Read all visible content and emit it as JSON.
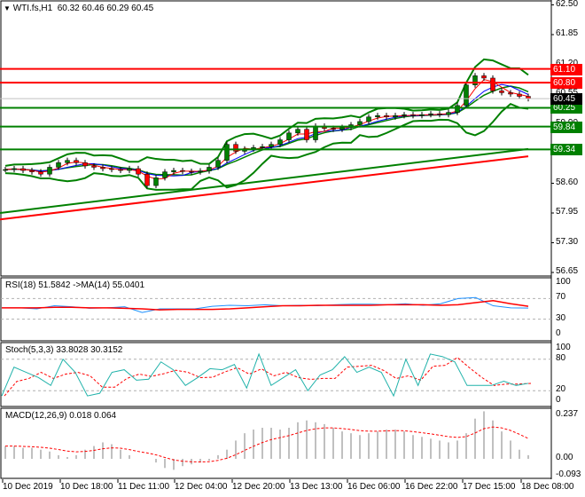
{
  "header": {
    "symbol": "WTI.fs,H1",
    "ohlc": "60.32 60.46 60.29 60.45"
  },
  "panels": {
    "rsi": {
      "title": "RSI(18) 51.5842  ->MA(14) 55.0401",
      "ticks": [
        "100",
        "70",
        "30",
        "0"
      ]
    },
    "stoch": {
      "title": "Stoch(5,3,3) 33.8028 30.3152",
      "ticks": [
        "100",
        "80",
        "20",
        "0"
      ]
    },
    "macd": {
      "title": "MACD(12,26,9) 0.018 0.064",
      "ticks": [
        "0.237",
        "0.00",
        "-0.093"
      ]
    }
  },
  "colors": {
    "bull": "#008000",
    "bear": "#ff0000",
    "red": "#ff0000",
    "green": "#008000",
    "blue": "#0000ff",
    "rsi": "#1e90ff",
    "stoch": "#20b2aa",
    "hist": "#c0c0c0"
  },
  "chart_data": [
    {
      "type": "candlestick",
      "title": "WTI.fs,H1",
      "ylim": [
        56.65,
        62.5
      ],
      "yticks": [
        "62.50",
        "61.85",
        "61.20",
        "60.55",
        "59.90",
        "59.25",
        "58.60",
        "57.95",
        "57.30",
        "56.65"
      ],
      "closes": [
        58.9,
        58.92,
        58.88,
        58.85,
        58.8,
        58.95,
        59.05,
        59.1,
        59.05,
        58.98,
        58.95,
        58.92,
        58.9,
        58.88,
        58.92,
        58.8,
        58.55,
        58.72,
        58.85,
        58.88,
        58.86,
        58.85,
        58.87,
        58.95,
        59.1,
        59.45,
        59.3,
        59.35,
        59.38,
        59.4,
        59.45,
        59.55,
        59.7,
        59.78,
        59.55,
        59.85,
        59.8,
        59.78,
        59.82,
        59.88,
        59.95,
        60.05,
        60.08,
        60.05,
        60.08,
        60.1,
        60.08,
        60.1,
        60.12,
        60.1,
        60.15,
        60.3,
        60.75,
        60.95,
        60.9,
        60.62,
        60.58,
        60.55,
        60.5,
        60.45
      ],
      "levels": [
        {
          "price": "61.10",
          "color": "red"
        },
        {
          "price": "60.80",
          "color": "red"
        },
        {
          "price": "60.25",
          "color": "green"
        },
        {
          "price": "59.84",
          "color": "green"
        },
        {
          "price": "59.34",
          "color": "green"
        }
      ],
      "current_price": "60.45",
      "long_ma": [
        {
          "color": "green",
          "start": 57.95,
          "end": 59.35
        },
        {
          "color": "red",
          "start": 57.81,
          "end": 59.19
        }
      ]
    },
    {
      "type": "line",
      "title": "RSI(18)",
      "ylim": [
        0,
        100
      ],
      "rsi": [
        52,
        52,
        50,
        56,
        54,
        51,
        52,
        54,
        43,
        50,
        50,
        50,
        55,
        57,
        56,
        58,
        56,
        57,
        56,
        58,
        59,
        59,
        58,
        60,
        57,
        60,
        70,
        72,
        56,
        52,
        51.6
      ],
      "ma": [
        52,
        52,
        52,
        53,
        53,
        52,
        52,
        51,
        50,
        48,
        49,
        49,
        49,
        50,
        52,
        54,
        56,
        56,
        57,
        57,
        57,
        57,
        58,
        58,
        58,
        57,
        58,
        62,
        66,
        60,
        55
      ]
    },
    {
      "type": "line",
      "title": "Stoch(5,3,3)",
      "ylim": [
        0,
        100
      ],
      "main": [
        10,
        65,
        55,
        45,
        30,
        80,
        55,
        10,
        15,
        55,
        60,
        40,
        42,
        75,
        60,
        30,
        45,
        62,
        60,
        70,
        25,
        90,
        30,
        45,
        60,
        20,
        50,
        60,
        85,
        55,
        65,
        55,
        10,
        80,
        30,
        90,
        85,
        75,
        30,
        30,
        30,
        38,
        30,
        34
      ]
    },
    {
      "type": "bar",
      "title": "MACD(12,26,9)",
      "ylim": [
        -0.093,
        0.237
      ],
      "hist": [
        0.07,
        0.07,
        0.06,
        0.06,
        0.05,
        0.04,
        0.02,
        0.01,
        0.02,
        0.05,
        0.07,
        0.09,
        0.08,
        0.05,
        0.02,
        0.0,
        0.0,
        -0.02,
        -0.05,
        -0.06,
        -0.04,
        -0.03,
        -0.02,
        -0.01,
        0.02,
        0.05,
        0.1,
        0.14,
        0.16,
        0.17,
        0.17,
        0.16,
        0.17,
        0.2,
        0.21,
        0.2,
        0.19,
        0.17,
        0.15,
        0.14,
        0.13,
        0.14,
        0.15,
        0.16,
        0.16,
        0.15,
        0.13,
        0.12,
        0.11,
        0.1,
        0.09,
        0.1,
        0.14,
        0.22,
        0.26,
        0.21,
        0.15,
        0.1,
        0.05,
        0.02
      ]
    }
  ],
  "time_axis": [
    "10 Dec 2019",
    "10 Dec 18:00",
    "11 Dec 11:00",
    "12 Dec 04:00",
    "12 Dec 20:00",
    "13 Dec 13:00",
    "16 Dec 06:00",
    "16 Dec 22:00",
    "17 Dec 15:00",
    "18 Dec 08:00"
  ]
}
